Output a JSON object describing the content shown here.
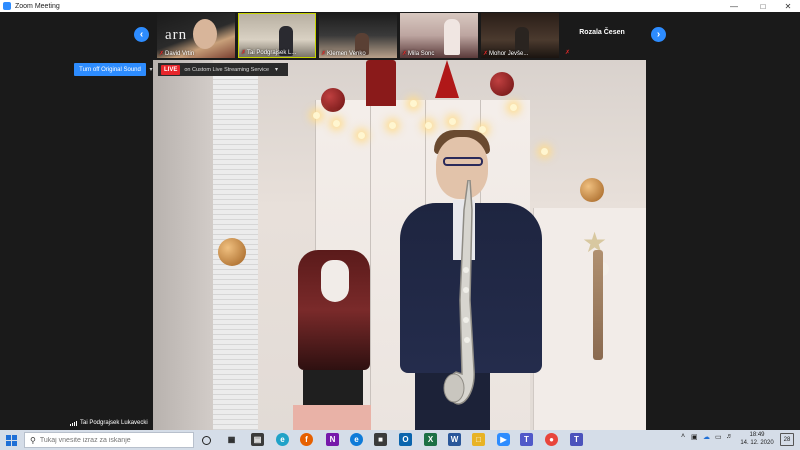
{
  "window": {
    "title": "Zoom Meeting",
    "minimize_icon": "minimize-icon",
    "maximize_icon": "maximize-icon",
    "close_icon": "close-icon"
  },
  "gallery": {
    "prev_icon": "chevron-left-icon",
    "next_icon": "chevron-right-icon",
    "participants": [
      {
        "name": "David Vrtin",
        "muted": true,
        "logo_text": "arn"
      },
      {
        "name": "Tai Podgrajsek L...",
        "muted": true
      },
      {
        "name": "Klemen Venko",
        "muted": true
      },
      {
        "name": "Mila Sonc",
        "muted": true
      },
      {
        "name": "Mohor Jevše...",
        "muted": true
      },
      {
        "name": "Rozala Česen",
        "muted": true,
        "video_off": true
      }
    ],
    "active_speaker_highlight": "#c8d400"
  },
  "controls": {
    "original_sound_button": "Turn off Original Sound",
    "live_badge": "LIVE",
    "live_text": "on Custom Live Streaming Service",
    "accent": "#2d8cff",
    "live_color": "#e8262b"
  },
  "main_video": {
    "speaker_name": "Tai Podgrajsek Lukavecki",
    "signal_icon": "signal-bars-icon"
  },
  "taskbar": {
    "search_placeholder": "Tukaj vnesite izraz za iskanje",
    "apps": [
      "task-view-icon",
      "edge-legacy-icon",
      "store-icon",
      "browser-icon",
      "firefox-icon",
      "onenote-icon",
      "edge-icon",
      "sticky-icon",
      "outlook-icon",
      "excel-icon",
      "word-icon",
      "file-explorer-icon",
      "zoom-icon",
      "teams-icon",
      "chrome-icon",
      "teams-alt-icon"
    ],
    "time": "18:49",
    "date": "14. 12. 2020",
    "notification_count": "28"
  }
}
